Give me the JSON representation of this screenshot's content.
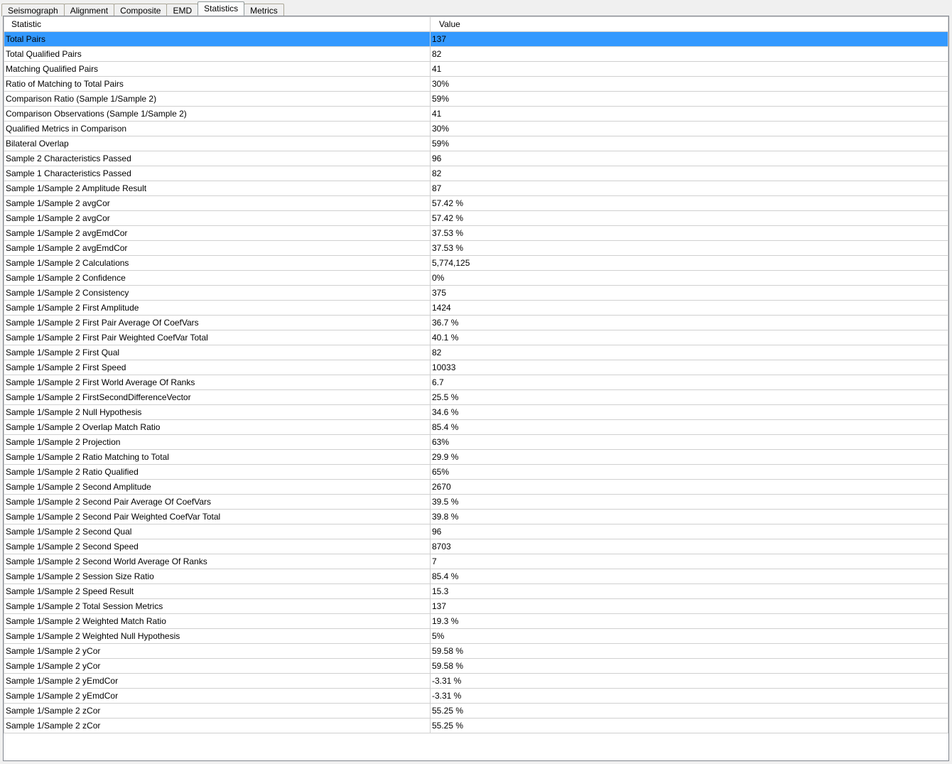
{
  "tabs": [
    {
      "label": "Seismograph",
      "active": false
    },
    {
      "label": "Alignment",
      "active": false
    },
    {
      "label": "Composite",
      "active": false
    },
    {
      "label": "EMD",
      "active": false
    },
    {
      "label": "Statistics",
      "active": true
    },
    {
      "label": "Metrics",
      "active": false
    }
  ],
  "table": {
    "headers": {
      "statistic": "Statistic",
      "value": "Value"
    },
    "selected_index": 0,
    "rows": [
      {
        "stat": "Total Pairs",
        "val": "137"
      },
      {
        "stat": "Total Qualified Pairs",
        "val": "82"
      },
      {
        "stat": "Matching Qualified Pairs",
        "val": "41"
      },
      {
        "stat": "Ratio of Matching to Total Pairs",
        "val": "30%"
      },
      {
        "stat": "Comparison Ratio (Sample 1/Sample 2)",
        "val": "59%"
      },
      {
        "stat": "Comparison Observations (Sample 1/Sample 2)",
        "val": "41"
      },
      {
        "stat": "Qualified Metrics in Comparison",
        "val": "30%"
      },
      {
        "stat": "Bilateral Overlap",
        "val": "59%"
      },
      {
        "stat": "Sample 2 Characteristics Passed",
        "val": "96"
      },
      {
        "stat": "Sample 1 Characteristics Passed",
        "val": "82"
      },
      {
        "stat": "Sample 1/Sample 2 Amplitude Result",
        "val": "87"
      },
      {
        "stat": "Sample 1/Sample 2 avgCor",
        "val": "57.42 %"
      },
      {
        "stat": "Sample 1/Sample 2 avgCor",
        "val": "57.42 %"
      },
      {
        "stat": "Sample 1/Sample 2 avgEmdCor",
        "val": "37.53 %"
      },
      {
        "stat": "Sample 1/Sample 2 avgEmdCor",
        "val": "37.53 %"
      },
      {
        "stat": "Sample 1/Sample 2 Calculations",
        "val": "5,774,125"
      },
      {
        "stat": "Sample 1/Sample 2 Confidence",
        "val": "0%"
      },
      {
        "stat": "Sample 1/Sample 2 Consistency",
        "val": "375"
      },
      {
        "stat": "Sample 1/Sample 2 First Amplitude",
        "val": "1424"
      },
      {
        "stat": "Sample 1/Sample 2 First Pair Average Of CoefVars",
        "val": "36.7 %"
      },
      {
        "stat": "Sample 1/Sample 2 First Pair Weighted CoefVar Total",
        "val": "40.1 %"
      },
      {
        "stat": "Sample 1/Sample 2 First Qual",
        "val": "82"
      },
      {
        "stat": "Sample 1/Sample 2 First Speed",
        "val": "10033"
      },
      {
        "stat": "Sample 1/Sample 2 First World Average Of Ranks",
        "val": "6.7"
      },
      {
        "stat": "Sample 1/Sample 2 FirstSecondDifferenceVector",
        "val": "25.5 %"
      },
      {
        "stat": "Sample 1/Sample 2 Null Hypothesis",
        "val": "34.6 %"
      },
      {
        "stat": "Sample 1/Sample 2 Overlap Match Ratio",
        "val": "85.4 %"
      },
      {
        "stat": "Sample 1/Sample 2 Projection",
        "val": "63%"
      },
      {
        "stat": "Sample 1/Sample 2 Ratio Matching to Total",
        "val": "29.9 %"
      },
      {
        "stat": "Sample 1/Sample 2 Ratio Qualified",
        "val": "65%"
      },
      {
        "stat": "Sample 1/Sample 2 Second Amplitude",
        "val": "2670"
      },
      {
        "stat": "Sample 1/Sample 2 Second Pair Average Of CoefVars",
        "val": "39.5 %"
      },
      {
        "stat": "Sample 1/Sample 2 Second Pair Weighted CoefVar Total",
        "val": "39.8 %"
      },
      {
        "stat": "Sample 1/Sample 2 Second Qual",
        "val": "96"
      },
      {
        "stat": "Sample 1/Sample 2 Second Speed",
        "val": "8703"
      },
      {
        "stat": "Sample 1/Sample 2 Second World Average Of Ranks",
        "val": "7"
      },
      {
        "stat": "Sample 1/Sample 2 Session Size Ratio",
        "val": "85.4 %"
      },
      {
        "stat": "Sample 1/Sample 2 Speed Result",
        "val": "15.3"
      },
      {
        "stat": "Sample 1/Sample 2 Total Session Metrics",
        "val": "137"
      },
      {
        "stat": "Sample 1/Sample 2 Weighted Match Ratio",
        "val": "19.3 %"
      },
      {
        "stat": "Sample 1/Sample 2 Weighted Null Hypothesis",
        "val": "5%"
      },
      {
        "stat": "Sample 1/Sample 2 yCor",
        "val": "59.58 %"
      },
      {
        "stat": "Sample 1/Sample 2 yCor",
        "val": "59.58 %"
      },
      {
        "stat": "Sample 1/Sample 2 yEmdCor",
        "val": "-3.31 %"
      },
      {
        "stat": "Sample 1/Sample 2 yEmdCor",
        "val": "-3.31 %"
      },
      {
        "stat": "Sample 1/Sample 2 zCor",
        "val": "55.25 %"
      },
      {
        "stat": "Sample 1/Sample 2 zCor",
        "val": "55.25 %"
      }
    ]
  }
}
